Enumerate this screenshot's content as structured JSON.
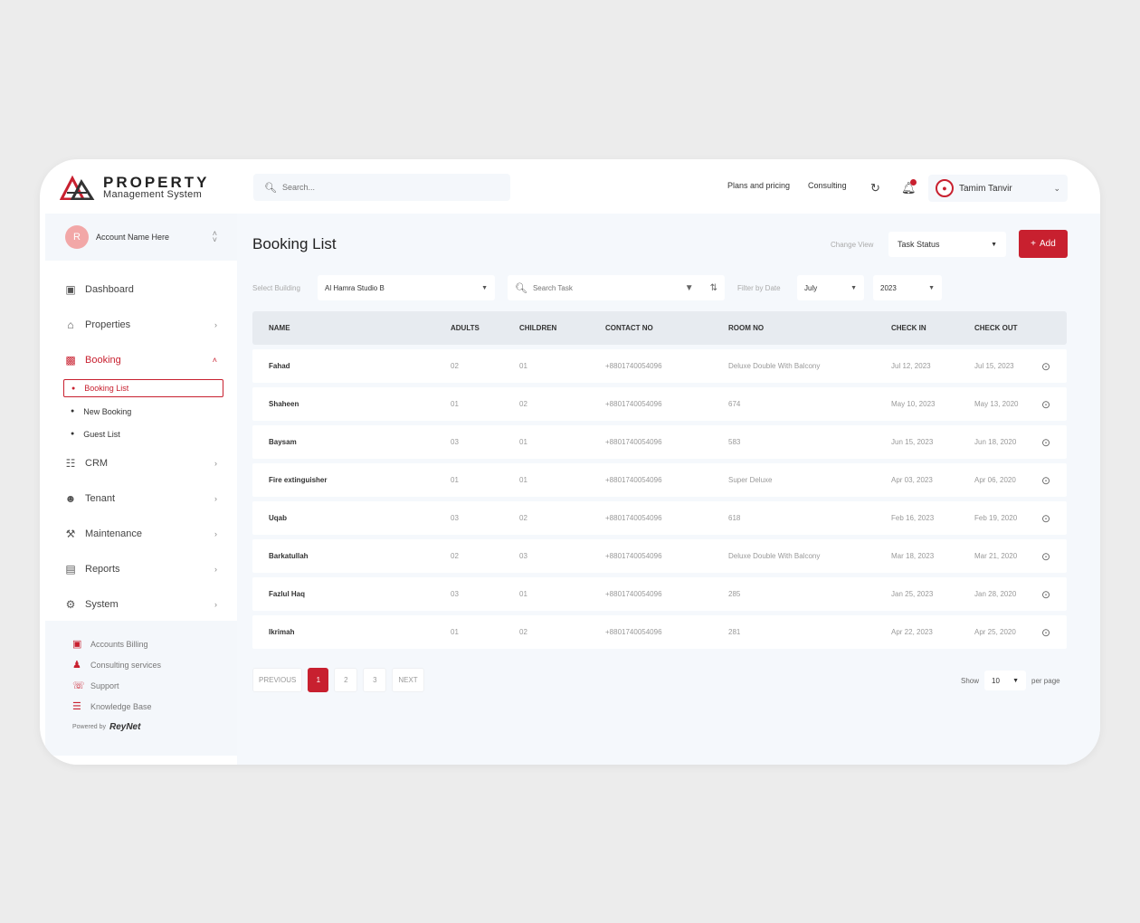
{
  "brand": {
    "title": "PROPERTY",
    "subtitle": "Management System"
  },
  "header": {
    "search_placeholder": "Search...",
    "links": [
      "Plans and pricing",
      "Consulting"
    ],
    "user_name": "Tamim Tanvir"
  },
  "sidebar": {
    "account": {
      "initial": "R",
      "name": "Account Name Here"
    },
    "items": [
      {
        "label": "Dashboard",
        "icon": "dashboard-icon",
        "has_arrow": false
      },
      {
        "label": "Properties",
        "icon": "building-icon",
        "has_arrow": true
      },
      {
        "label": "Booking",
        "icon": "booking-icon",
        "has_arrow": true,
        "expanded": true
      },
      {
        "label": "CRM",
        "icon": "crm-icon",
        "has_arrow": true
      },
      {
        "label": "Tenant",
        "icon": "tenant-icon",
        "has_arrow": true
      },
      {
        "label": "Maintenance",
        "icon": "tools-icon",
        "has_arrow": true
      },
      {
        "label": "Reports",
        "icon": "reports-icon",
        "has_arrow": true
      },
      {
        "label": "System",
        "icon": "system-icon",
        "has_arrow": true
      }
    ],
    "booking_sub": [
      "Booking List",
      "New Booking",
      "Guest List"
    ],
    "bottom_links": [
      "Accounts Billing",
      "Consulting services",
      "Support",
      "Knowledge Base"
    ],
    "powered_by": "Powered by",
    "powered_brand": "ReyNet"
  },
  "main": {
    "title": "Booking List",
    "change_view_label": "Change View",
    "change_view_value": "Task Status",
    "add_label": "Add",
    "filters": {
      "building_label": "Select Building",
      "building_value": "Al Hamra Studio B",
      "search_placeholder": "Search Task",
      "date_label": "Filter by Date",
      "month": "July",
      "year": "2023"
    }
  },
  "table": {
    "columns": [
      "NAME",
      "ADULTS",
      "CHILDREN",
      "CONTACT NO",
      "ROOM NO",
      "CHECK IN",
      "CHECK OUT"
    ],
    "rows": [
      [
        "Fahad",
        "02",
        "01",
        "+8801740054096",
        "Deluxe Double With Balcony",
        "Jul 12, 2023",
        "Jul 15, 2023"
      ],
      [
        "Shaheen",
        "01",
        "02",
        "+8801740054096",
        "674",
        "May 10, 2023",
        "May 13, 2020"
      ],
      [
        "Baysam",
        "03",
        "01",
        "+8801740054096",
        "583",
        "Jun 15, 2023",
        "Jun 18, 2020"
      ],
      [
        "Fire extinguisher",
        "01",
        "01",
        "+8801740054096",
        "Super Deluxe",
        "Apr 03, 2023",
        "Apr 06, 2020"
      ],
      [
        "Uqab",
        "03",
        "02",
        "+8801740054096",
        "618",
        "Feb 16, 2023",
        "Feb 19, 2020"
      ],
      [
        "Barkatullah",
        "02",
        "03",
        "+8801740054096",
        "Deluxe Double With Balcony",
        "Mar 18, 2023",
        "Mar 21, 2020"
      ],
      [
        "Fazlul Haq",
        "03",
        "01",
        "+8801740054096",
        "285",
        "Jan 25, 2023",
        "Jan 28, 2020"
      ],
      [
        "Ikrimah",
        "01",
        "02",
        "+8801740054096",
        "281",
        "Apr 22, 2023",
        "Apr 25, 2020"
      ]
    ]
  },
  "pagination": {
    "prev": "PREVIOUS",
    "pages": [
      "1",
      "2",
      "3"
    ],
    "current": "1",
    "next": "NEXT",
    "show_label": "Show",
    "per_page_value": "10",
    "per_page_label": "per page"
  },
  "colors": {
    "accent": "#c8202f",
    "background": "#f5f8fc"
  }
}
